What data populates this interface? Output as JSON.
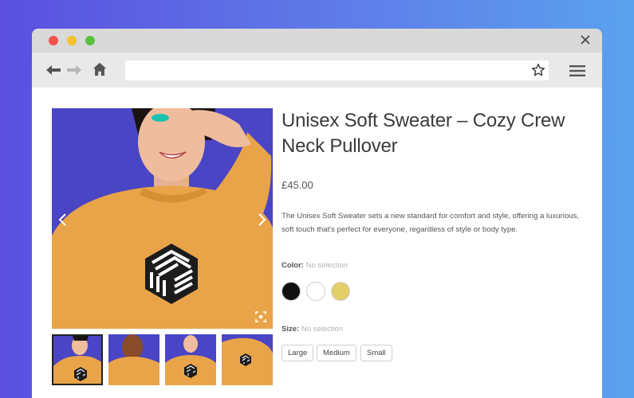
{
  "window": {
    "controls": [
      "close",
      "minimize",
      "maximize"
    ],
    "close_icon": "close-icon"
  },
  "toolbar": {
    "back_icon": "arrow-left-icon",
    "forward_icon": "arrow-right-icon",
    "home_icon": "home-icon",
    "url": "",
    "bookmark_icon": "star-icon",
    "menu_icon": "hamburger-menu-icon"
  },
  "gallery": {
    "prev_icon": "chevron-left-icon",
    "next_icon": "chevron-right-icon",
    "zoom_icon": "zoom-icon",
    "thumbnail_count": 4,
    "active_thumbnail": 1
  },
  "product": {
    "title": "Unisex Soft Sweater – Cozy Crew Neck Pullover",
    "price": "£45.00",
    "description": "The Unisex Soft Sweater sets a new standard for comfort and style, offering a luxurious, soft touch that's perfect for everyone, regardless of style or body type.",
    "color": {
      "label": "Color:",
      "selection": "No selection",
      "swatches": [
        {
          "name": "Black",
          "hex": "#111111"
        },
        {
          "name": "White",
          "hex": "#ffffff"
        },
        {
          "name": "Yellow",
          "hex": "#e2cf68"
        }
      ]
    },
    "size": {
      "label": "Size:",
      "selection": "No selection",
      "options": [
        "Large",
        "Medium",
        "Small"
      ]
    }
  },
  "colors": {
    "background_start": "#5a4fe0",
    "background_end": "#5aa2ee",
    "image_bg": "#4a45c4",
    "sweater": "#e9a449"
  }
}
